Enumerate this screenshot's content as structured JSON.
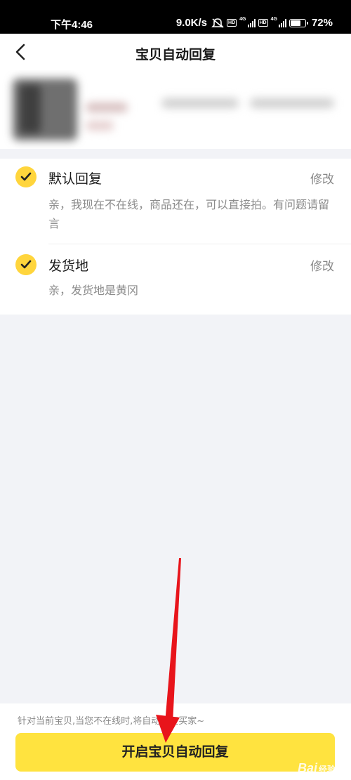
{
  "status_bar": {
    "time": "下午4:46",
    "network_speed": "9.0K/s",
    "battery_percent": "72%",
    "battery_level": 0.72,
    "icons": [
      "mute-icon",
      "hd-icon",
      "4g-signal-icon",
      "hd-icon",
      "4g-signal-icon",
      "battery-icon"
    ]
  },
  "nav": {
    "title": "宝贝自动回复",
    "back_icon": "chevron-left-icon"
  },
  "replies": [
    {
      "title": "默认回复",
      "edit_label": "修改",
      "body": "亲，我现在不在线，商品还在，可以直接拍。有问题请留言",
      "checked": true
    },
    {
      "title": "发货地",
      "edit_label": "修改",
      "body": "亲，发货地是黄冈",
      "checked": true
    }
  ],
  "footer": {
    "hint": "针对当前宝贝,当您不在线时,将自动回复买家~",
    "button_label": "开启宝贝自动回复"
  },
  "watermark": {
    "brand": "Bai",
    "suffix": "经验"
  },
  "colors": {
    "accent": "#ffe33f",
    "check": "#ffd53c",
    "annotation_arrow": "#e8141b"
  }
}
